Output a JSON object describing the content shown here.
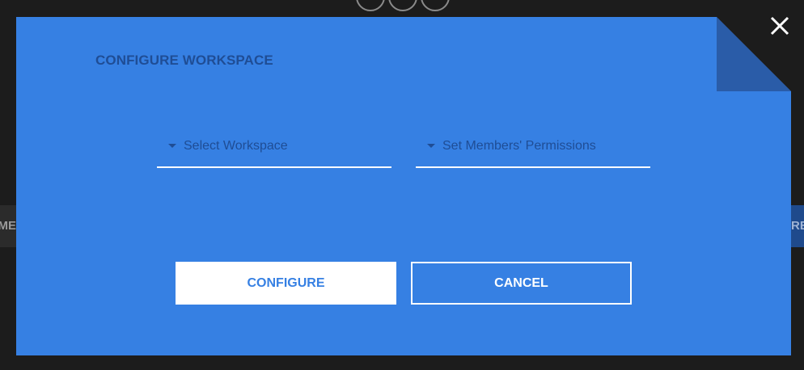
{
  "background": {
    "left_tab_label": "ME",
    "right_tab_label": "RES"
  },
  "modal": {
    "title": "CONFIGURE WORKSPACE",
    "close_icon": "close-icon",
    "workspace_select": {
      "placeholder": "Select Workspace",
      "icon": "caret-down-icon"
    },
    "permissions_select": {
      "placeholder": "Set Members' Permissions",
      "icon": "caret-down-icon"
    },
    "configure_button": "CONFIGURE",
    "cancel_button": "CANCEL"
  },
  "colors": {
    "modal_bg": "#3680e3",
    "fold": "#2a5ca8",
    "title_text": "#1f4d95",
    "page_bg": "#1c1c1c"
  }
}
